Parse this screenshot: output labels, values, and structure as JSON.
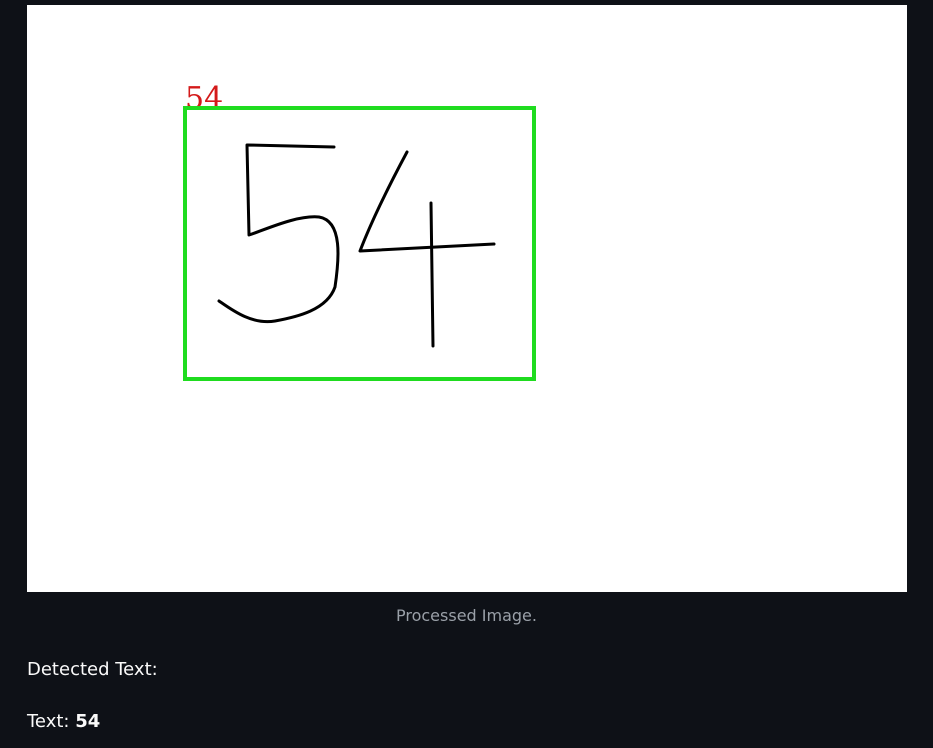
{
  "image": {
    "overlay_label": "54",
    "box_color": "#1fdc1f",
    "label_color": "#d41a1a",
    "stroke_color": "#000000"
  },
  "caption": "Processed Image.",
  "detected_heading": "Detected Text:",
  "result": {
    "prefix": "Text: ",
    "value": "54"
  }
}
